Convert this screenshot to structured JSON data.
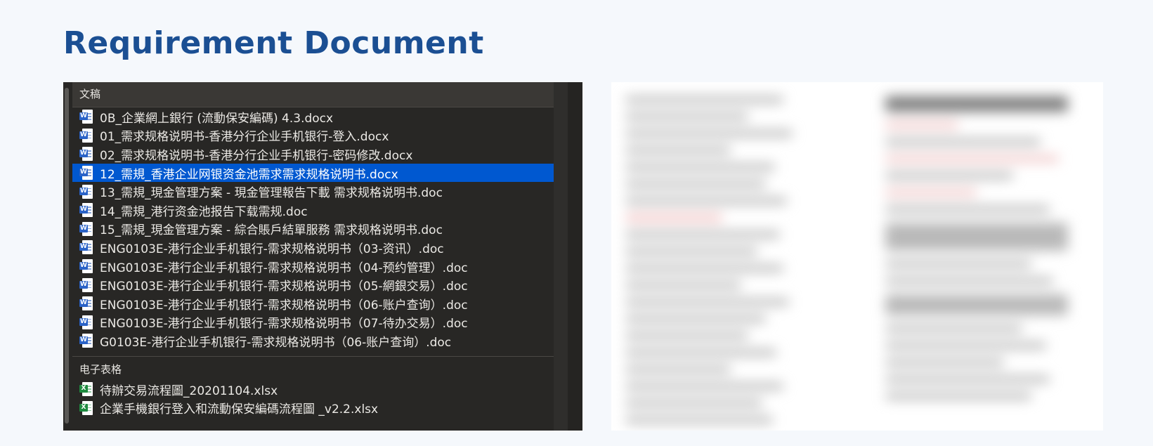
{
  "page": {
    "title": "Requirement Document"
  },
  "finder": {
    "documents_header": "文稿",
    "spreadsheets_header": "电子表格",
    "selected_index": 3,
    "documents": [
      {
        "name": "0B_企業網上銀行 (流動保安編碼) 4.3.docx",
        "icon": "word-icon"
      },
      {
        "name": "01_需求规格说明书-香港分行企业手机银行-登入.docx",
        "icon": "word-icon"
      },
      {
        "name": "02_需求规格说明书-香港分行企业手机银行-密码修改.docx",
        "icon": "word-icon"
      },
      {
        "name": "12_需規_香港企业网银资金池需求需求规格说明书.docx",
        "icon": "word-icon"
      },
      {
        "name": "13_需規_現金管理方案 - 現金管理報告下載  需求规格说明书.doc",
        "icon": "word-icon"
      },
      {
        "name": "14_需規_港行资金池报告下载需规.doc",
        "icon": "word-icon"
      },
      {
        "name": "15_需規_現金管理方案 - 綜合賬戶結單服務  需求规格说明书.doc",
        "icon": "word-icon"
      },
      {
        "name": "ENG0103E-港行企业手机银行-需求规格说明书（03-资讯）.doc",
        "icon": "word-icon"
      },
      {
        "name": "ENG0103E-港行企业手机银行-需求规格说明书（04-预约管理）.doc",
        "icon": "word-icon"
      },
      {
        "name": "ENG0103E-港行企业手机银行-需求规格说明书（05-網銀交易）.doc",
        "icon": "word-icon"
      },
      {
        "name": "ENG0103E-港行企业手机银行-需求规格说明书（06-账户查询）.doc",
        "icon": "word-icon"
      },
      {
        "name": "ENG0103E-港行企业手机银行-需求规格说明书（07-待办交易）.doc",
        "icon": "word-icon"
      },
      {
        "name": "G0103E-港行企业手机银行-需求规格说明书（06-账户查询）.doc",
        "icon": "word-icon"
      }
    ],
    "spreadsheets": [
      {
        "name": "待辦交易流程圖_20201104.xlsx",
        "icon": "excel-icon"
      },
      {
        "name": "企業手機銀行登入和流動保安編碼流程圖 _v2.2.xlsx",
        "icon": "excel-icon"
      }
    ]
  },
  "colors": {
    "title": "#1b4f93",
    "selection": "#0058d0",
    "panel_bg": "#282725"
  }
}
